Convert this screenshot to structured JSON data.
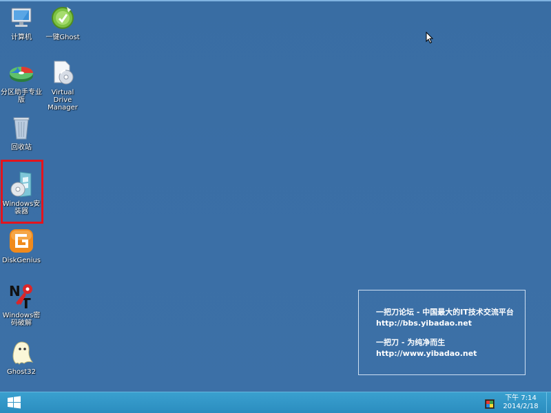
{
  "desktop": {
    "icons": [
      {
        "label": "计算机",
        "icon": "computer-icon"
      },
      {
        "label": "一键Ghost",
        "icon": "ghost-onekey-icon"
      },
      {
        "label": "分区助手专业版",
        "icon": "partition-assistant-icon"
      },
      {
        "label": "Virtual Drive Manager",
        "icon": "virtual-drive-icon"
      },
      {
        "label": "回收站",
        "icon": "recycle-bin-icon"
      },
      {
        "label": "Windows安装器",
        "icon": "windows-installer-icon"
      },
      {
        "label": "DiskGenius",
        "icon": "diskgenius-icon"
      },
      {
        "label": "Windows密码破解",
        "icon": "password-crack-icon"
      },
      {
        "label": "Ghost32",
        "icon": "ghost32-icon"
      }
    ],
    "highlight_color": "#e4141d"
  },
  "info_panel": {
    "line1": "一把刀论坛 - 中国最大的IT技术交流平台",
    "line2": "http://bbs.yibadao.net",
    "line3": "一把刀 - 为纯净而生",
    "line4": "http://www.yibadao.net"
  },
  "taskbar": {
    "start_icon": "windows-logo-icon",
    "tray_icon": "network-tray-icon",
    "time": "下午 7:14",
    "date": "2014/2/18"
  },
  "colors": {
    "desktop_background": "#3a6ea5",
    "taskbar": "#2c8fc0"
  }
}
